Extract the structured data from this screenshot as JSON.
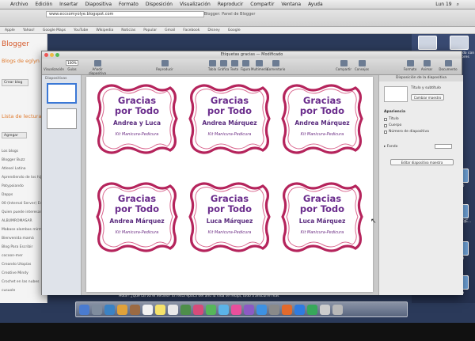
{
  "menubar": {
    "items": [
      "Archivo",
      "Edición",
      "Insertar",
      "Diapositiva",
      "Formato",
      "Disposición",
      "Visualización",
      "Reproducir",
      "Compartir",
      "Ventana",
      "Ayuda"
    ],
    "clock": "Lun 19"
  },
  "browser": {
    "tab_title": "Blogger: Panel de Blogger",
    "url": "www.eccsomyolye.blogspot.com",
    "bookmarks": [
      "Apple",
      "Yahoo!",
      "Google Maps",
      "YouTube",
      "Wikipedia",
      "Noticias",
      "Popular",
      "Gmail",
      "Facebook",
      "Disney",
      "Google"
    ]
  },
  "blogger": {
    "logo": "Blogger",
    "blog_title": "Blogs de eglyn",
    "create_button": "Crear blog",
    "reading_list_title": "Lista de lectura",
    "add_button": "Agregar",
    "blogs": [
      "Los blogs",
      "Blogger Buzz",
      "Atlesel Latina",
      "Aprendiendo de los hijos",
      "Patypoiando",
      "Dapps",
      "00 (Internal Server) Err...",
      "Quien puede interesar",
      "ALBUMROMASAR",
      "Mabase alambos mirma",
      "Bienvenida mamá",
      "Blog Para Escribir",
      "cocoon-mer",
      "Creando Utopías",
      "Creative Mindy",
      "Crochet en las nubes",
      "cusuole"
    ]
  },
  "keynote": {
    "window_title": "Etiquetas gracias — Modificado",
    "zoom": "100%",
    "toolbar": [
      "Visualización",
      "Guías",
      "Añadir diapositiva",
      "Reproducir",
      "Tabla",
      "Gráfica",
      "Texto",
      "Figura",
      "Multimedia",
      "Comentario",
      "Compartir",
      "Consejos",
      "Formato",
      "Animar",
      "Documento"
    ],
    "navigator_label": "Diapositivas",
    "labels": [
      {
        "title1": "Gracias",
        "title2": "por Todo",
        "name": "Andrea y Luca",
        "kit": "Kit Manicura-Pedicura"
      },
      {
        "title1": "Gracias",
        "title2": "por Todo",
        "name": "Andrea Márquez",
        "kit": "Kit Manicura-Pedicura"
      },
      {
        "title1": "Gracias",
        "title2": "por Todo",
        "name": "Andrea Márquez",
        "kit": "Kit Manicura-Pedicura"
      },
      {
        "title1": "Gracias",
        "title2": "por Todo",
        "name": "Andrea Márquez",
        "kit": "Kit Manicura-Pedicura"
      },
      {
        "title1": "Gracias",
        "title2": "por Todo",
        "name": "Luca Márquez",
        "kit": "Kit Manicura-Pedicura"
      },
      {
        "title1": "Gracias",
        "title2": "por Todo",
        "name": "Luca Márquez",
        "kit": "Kit Manicura-Pedicura"
      }
    ],
    "inspector": {
      "header": "Disposición de la diapositiva",
      "title_subtitle": "Título y subtítulo",
      "change_master": "Cambiar maestro",
      "appearance": "Apariencia",
      "opt_title": "Título",
      "opt_body": "Cuerpo",
      "opt_number": "Número de diapositiva",
      "background": "Fondo",
      "edit_master": "Editar diapositiva maestra"
    }
  },
  "desktop": {
    "icon1": "Tarea Luca lo que le gusta",
    "icon2": "Organizando con Ca...ndores",
    "side_labels": [
      "FORO",
      "LAST PROJE...",
      "ALBU",
      "Carta"
    ]
  },
  "status_line": "Hola!! ¿Qué tal va el verano? En esta época del año la vida se relaja, todo transcurre más"
}
